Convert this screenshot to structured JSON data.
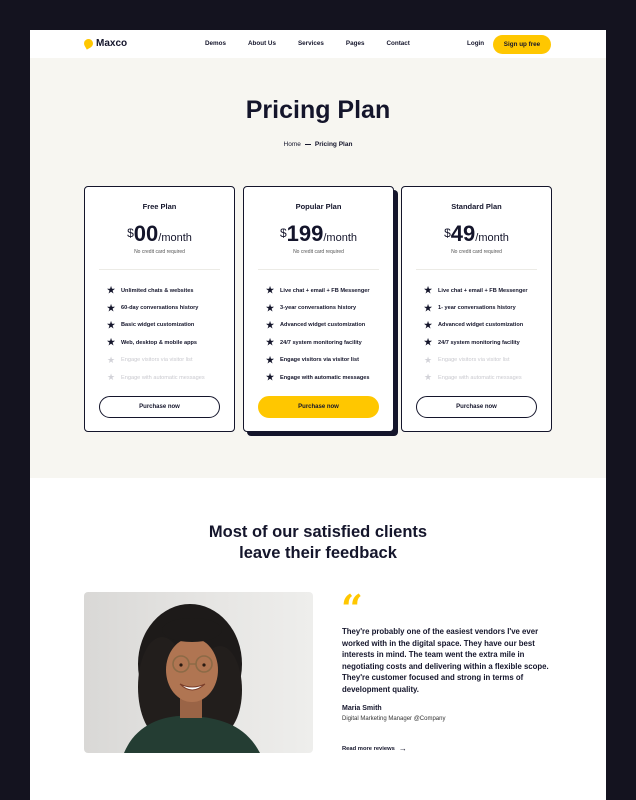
{
  "nav": {
    "logo": "Maxco",
    "links": [
      "Demos",
      "About Us",
      "Services",
      "Pages",
      "Contact"
    ],
    "login": "Login",
    "signup": "Sign up free"
  },
  "hero": {
    "title": "Pricing Plan",
    "breadcrumb": {
      "home": "Home",
      "current": "Pricing Plan"
    }
  },
  "plans": [
    {
      "name": "Free Plan",
      "currency": "$",
      "amount": "00",
      "period": "/month",
      "note": "No credit card required",
      "features": [
        {
          "text": "Unlimited chats & websites",
          "enabled": true
        },
        {
          "text": "60-day conversations history",
          "enabled": true
        },
        {
          "text": "Basic widget customization",
          "enabled": true
        },
        {
          "text": "Web, desktop & mobile apps",
          "enabled": true
        },
        {
          "text": "Engage visitors via visitor list",
          "enabled": false
        },
        {
          "text": "Engage with automatic messages",
          "enabled": false
        }
      ],
      "button": "Purchase now"
    },
    {
      "name": "Popular Plan",
      "currency": "$",
      "amount": "199",
      "period": "/month",
      "note": "No credit card required",
      "features": [
        {
          "text": "Live chat + email + FB Messenger",
          "enabled": true
        },
        {
          "text": "3-year conversations history",
          "enabled": true
        },
        {
          "text": "Advanced widget customization",
          "enabled": true
        },
        {
          "text": "24/7 system monitoring facility",
          "enabled": true
        },
        {
          "text": "Engage visitors via visitor list",
          "enabled": true
        },
        {
          "text": "Engage with automatic messages",
          "enabled": true
        }
      ],
      "button": "Purchase now"
    },
    {
      "name": "Standard Plan",
      "currency": "$",
      "amount": "49",
      "period": "/month",
      "note": "No credit card required",
      "features": [
        {
          "text": "Live chat + email + FB Messenger",
          "enabled": true
        },
        {
          "text": "1- year conversations history",
          "enabled": true
        },
        {
          "text": "Advanced widget customization",
          "enabled": true
        },
        {
          "text": "24/7 system monitoring facility",
          "enabled": true
        },
        {
          "text": "Engage visitors via visitor list",
          "enabled": false
        },
        {
          "text": "Engage with automatic messages",
          "enabled": false
        }
      ],
      "button": "Purchase now"
    }
  ],
  "testimonial": {
    "title_line1": "Most of our satisfied clients",
    "title_line2": "leave their feedback",
    "quote": "They're probably one of the easiest vendors I've ever worked with in the digital space. They have our best interests in mind. The team went the extra mile in negotiating costs and delivering within a flexible scope. They're customer focused and strong in terms of development quality.",
    "author": "Maria Smith",
    "role": "Digital Marketing Manager @Company",
    "more_link": "Read more reviews"
  },
  "colors": {
    "accent": "#ffc700",
    "dark": "#14152b",
    "hero_bg": "#f7f6f1"
  }
}
